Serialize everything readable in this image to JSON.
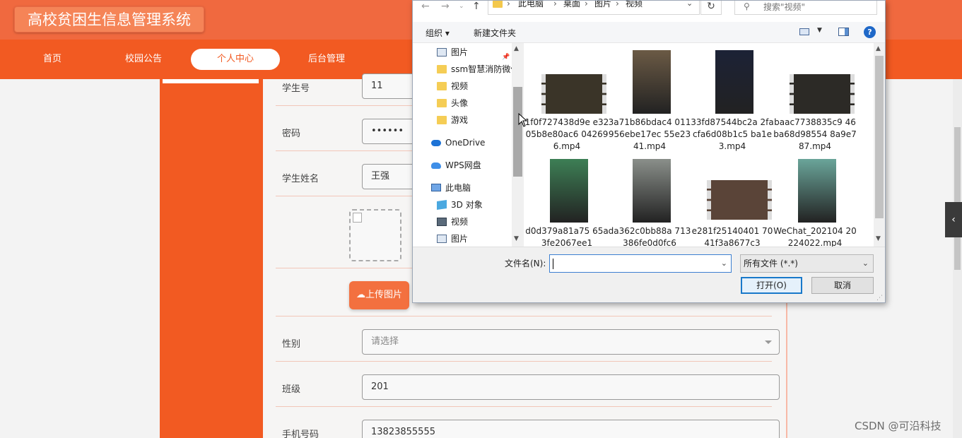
{
  "site": {
    "title": "高校贫困生信息管理系统",
    "nav": [
      {
        "label": "首页"
      },
      {
        "label": "校园公告"
      },
      {
        "label": "个人中心"
      },
      {
        "label": "后台管理"
      }
    ]
  },
  "form": {
    "student_id": {
      "label": "学生号",
      "value": "11"
    },
    "password": {
      "label": "密码",
      "value": "••••••"
    },
    "student_name": {
      "label": "学生姓名",
      "value": "王强"
    },
    "upload_label": "上传图片",
    "gender": {
      "label": "性别",
      "placeholder": "请选择"
    },
    "class": {
      "label": "班级",
      "value": "201"
    },
    "phone": {
      "label": "手机号码",
      "value": "13823855555"
    }
  },
  "watermark": "CSDN @可沿科技",
  "dialog": {
    "breadcrumbs": [
      "此电脑",
      "桌面",
      "图片",
      "视频"
    ],
    "search_placeholder": "搜索\"视频\"",
    "toolbar": {
      "organize": "组织 ▾",
      "new_folder": "新建文件夹"
    },
    "nav_items": [
      {
        "label": "图片",
        "icon": "picture-icon",
        "indent": 2
      },
      {
        "label": "ssm智慧消防微信",
        "icon": "folder-icon",
        "indent": 2
      },
      {
        "label": "视频",
        "icon": "folder-icon",
        "indent": 2
      },
      {
        "label": "头像",
        "icon": "folder-icon",
        "indent": 2
      },
      {
        "label": "游戏",
        "icon": "folder-icon",
        "indent": 2
      },
      {
        "label": "OneDrive",
        "icon": "onedrive-icon",
        "indent": 1
      },
      {
        "label": "WPS网盘",
        "icon": "wps-cloud-icon",
        "indent": 1
      },
      {
        "label": "此电脑",
        "icon": "computer-icon",
        "indent": 1
      },
      {
        "label": "3D 对象",
        "icon": "3d-objects-icon",
        "indent": 2
      },
      {
        "label": "视频",
        "icon": "video-folder-icon",
        "indent": 2
      },
      {
        "label": "图片",
        "icon": "picture-icon",
        "indent": 2
      }
    ],
    "files": [
      {
        "name": "1f0f727438d9e e3205b8e80ac6 042696.mp4",
        "thumb": "film",
        "tone": "#3a3428"
      },
      {
        "name": "3a71b86bdac4 011956ebe17ec 55e2341.mp4",
        "thumb": "portrait",
        "tone": "#6b5a45"
      },
      {
        "name": "33fd87544bc2a 2facfa6d08b1c5 ba1e3.mp4",
        "thumb": "portrait",
        "tone": "#1c2236"
      },
      {
        "name": "baac7738835c9 46ba68d98554 8a9e787.mp4",
        "thumb": "film",
        "tone": "#2c2a26"
      },
      {
        "name": "d0d379a81a75 65a3fe2067ee1",
        "thumb": "portrait",
        "tone": "#3d7f55"
      },
      {
        "name": "da362c0bb88a 713386fe0d0fc6",
        "thumb": "portrait",
        "tone": "#8a8f8a"
      },
      {
        "name": "e281f25140401 7041f3a8677c3",
        "thumb": "film",
        "tone": "#5a4438"
      },
      {
        "name": "WeChat_202104 20224022.mp4",
        "thumb": "portrait",
        "tone": "#6aa59a"
      }
    ],
    "filename_label": "文件名(N):",
    "filename_value": "",
    "filetype_value": "所有文件 (*.*)",
    "open_label": "打开(O)",
    "cancel_label": "取消"
  }
}
